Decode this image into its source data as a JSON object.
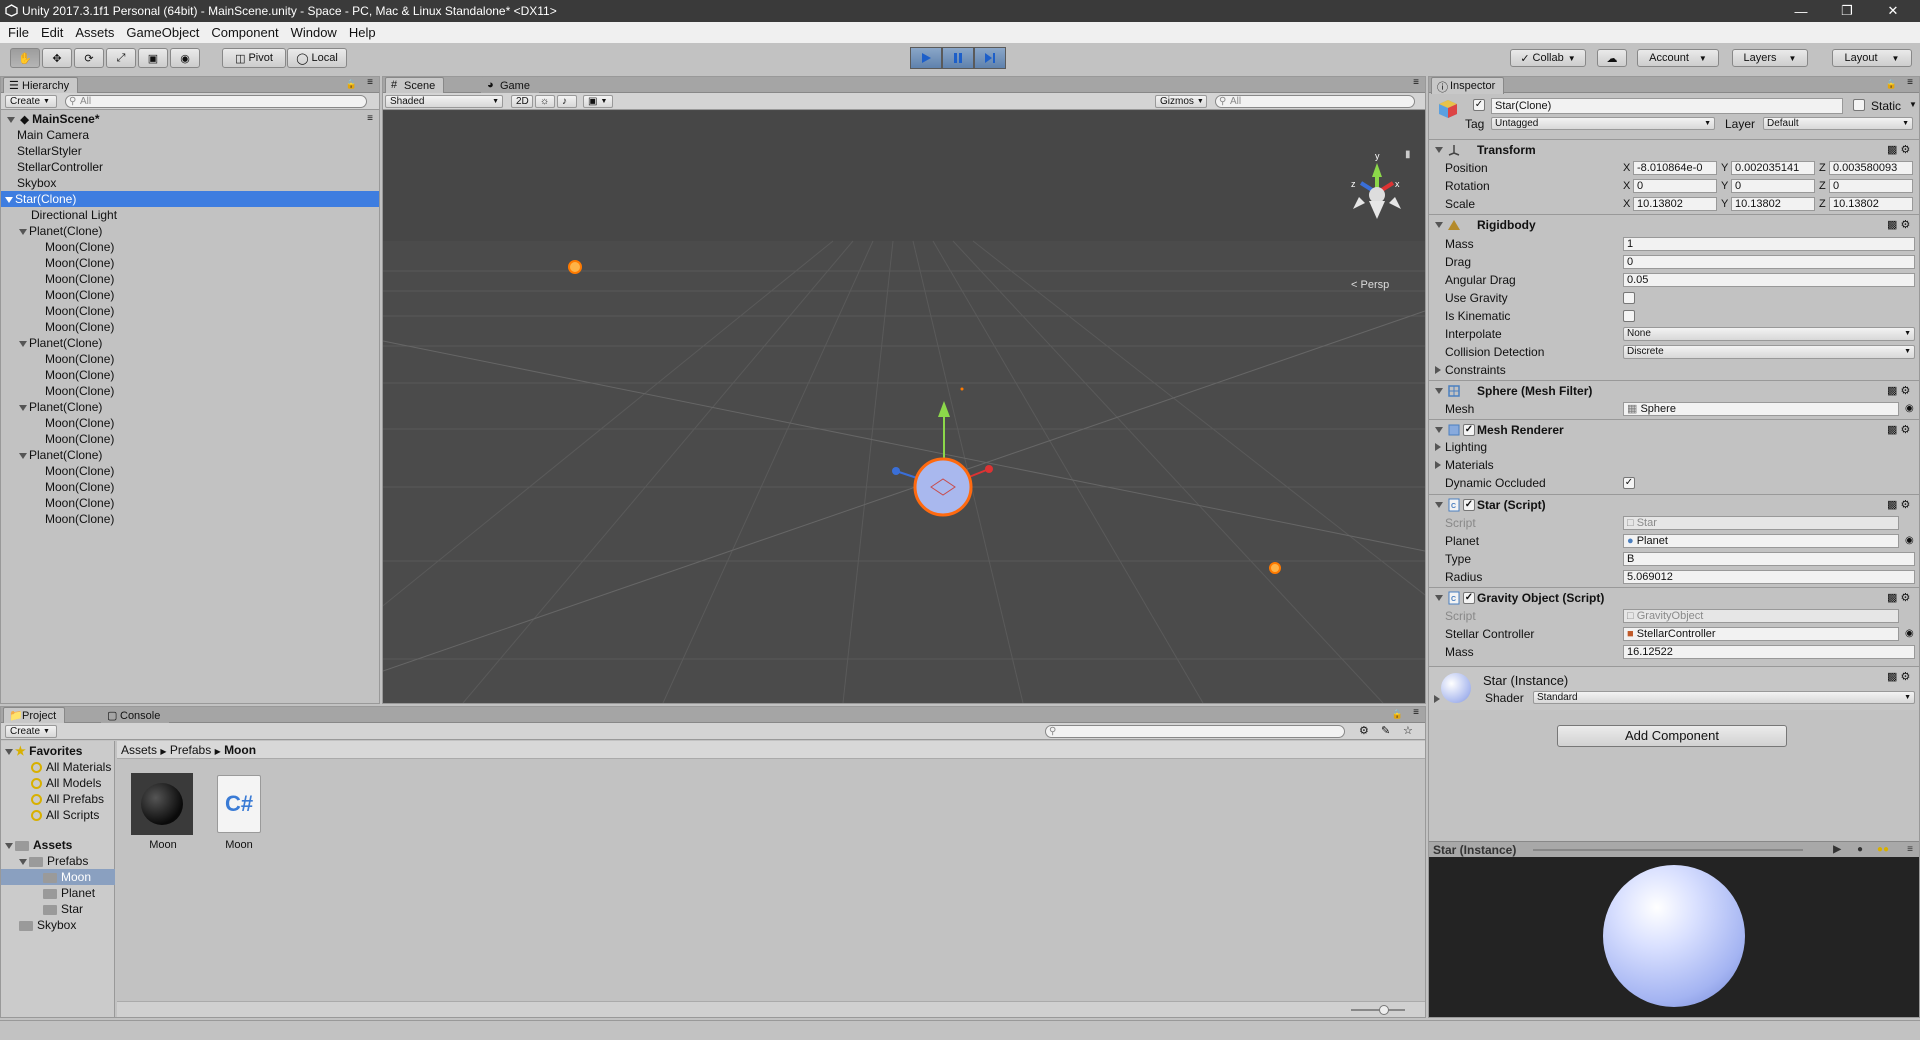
{
  "window": {
    "title": "Unity 2017.3.1f1 Personal (64bit) - MainScene.unity - Space - PC, Mac & Linux Standalone* <DX11>"
  },
  "menu": [
    "File",
    "Edit",
    "Assets",
    "GameObject",
    "Component",
    "Window",
    "Help"
  ],
  "toolbar": {
    "pivot_label": "Pivot",
    "local_label": "Local",
    "collab_label": "Collab",
    "account_label": "Account",
    "layers_label": "Layers",
    "layout_label": "Layout"
  },
  "hierarchy": {
    "tab": "Hierarchy",
    "create_label": "Create",
    "search_placeholder": "All",
    "scene": "MainScene*",
    "items": [
      {
        "label": "Main Camera",
        "depth": 1
      },
      {
        "label": "StellarStyler",
        "depth": 1
      },
      {
        "label": "StellarController",
        "depth": 1
      },
      {
        "label": "Skybox",
        "depth": 1
      },
      {
        "label": "Star(Clone)",
        "depth": 1,
        "selected": true,
        "expand": true
      },
      {
        "label": "Directional Light",
        "depth": 2
      },
      {
        "label": "Planet(Clone)",
        "depth": 2,
        "expand": true
      },
      {
        "label": "Moon(Clone)",
        "depth": 3
      },
      {
        "label": "Moon(Clone)",
        "depth": 3
      },
      {
        "label": "Moon(Clone)",
        "depth": 3
      },
      {
        "label": "Moon(Clone)",
        "depth": 3
      },
      {
        "label": "Moon(Clone)",
        "depth": 3
      },
      {
        "label": "Moon(Clone)",
        "depth": 3
      },
      {
        "label": "Planet(Clone)",
        "depth": 2,
        "expand": true
      },
      {
        "label": "Moon(Clone)",
        "depth": 3
      },
      {
        "label": "Moon(Clone)",
        "depth": 3
      },
      {
        "label": "Moon(Clone)",
        "depth": 3
      },
      {
        "label": "Planet(Clone)",
        "depth": 2,
        "expand": true
      },
      {
        "label": "Moon(Clone)",
        "depth": 3
      },
      {
        "label": "Moon(Clone)",
        "depth": 3
      },
      {
        "label": "Planet(Clone)",
        "depth": 2,
        "expand": true
      },
      {
        "label": "Moon(Clone)",
        "depth": 3
      },
      {
        "label": "Moon(Clone)",
        "depth": 3
      },
      {
        "label": "Moon(Clone)",
        "depth": 3
      },
      {
        "label": "Moon(Clone)",
        "depth": 3
      }
    ]
  },
  "scene": {
    "tab_scene": "Scene",
    "tab_game": "Game",
    "shading": "Shaded",
    "mode_2d": "2D",
    "gizmos": "Gizmos",
    "search_placeholder": "All",
    "persp_label": "Persp"
  },
  "project": {
    "tab_project": "Project",
    "tab_console": "Console",
    "create_label": "Create",
    "favorites_label": "Favorites",
    "favorites": [
      "All Materials",
      "All Models",
      "All Prefabs",
      "All Scripts"
    ],
    "assets_label": "Assets",
    "tree": [
      {
        "label": "Prefabs",
        "depth": 1,
        "expand": true
      },
      {
        "label": "Moon",
        "depth": 2,
        "selected": true
      },
      {
        "label": "Planet",
        "depth": 2
      },
      {
        "label": "Star",
        "depth": 2
      },
      {
        "label": "Skybox",
        "depth": 1
      }
    ],
    "breadcrumb": [
      "Assets",
      "Prefabs",
      "Moon"
    ],
    "items": [
      {
        "label": "Moon",
        "kind": "sphere"
      },
      {
        "label": "Moon",
        "kind": "script"
      }
    ]
  },
  "inspector": {
    "tab": "Inspector",
    "object_name": "Star(Clone)",
    "static_label": "Static",
    "tag_label": "Tag",
    "tag_value": "Untagged",
    "layer_label": "Layer",
    "layer_value": "Default",
    "transform": {
      "title": "Transform",
      "position_label": "Position",
      "rotation_label": "Rotation",
      "scale_label": "Scale",
      "position": [
        "-8.010864e-0",
        "0.002035141",
        "0.003580093"
      ],
      "rotation": [
        "0",
        "0",
        "0"
      ],
      "scale": [
        "10.13802",
        "10.13802",
        "10.13802"
      ]
    },
    "rigidbody": {
      "title": "Rigidbody",
      "mass_label": "Mass",
      "mass": "1",
      "drag_label": "Drag",
      "drag": "0",
      "angular_drag_label": "Angular Drag",
      "angular_drag": "0.05",
      "use_gravity_label": "Use Gravity",
      "is_kinematic_label": "Is Kinematic",
      "interpolate_label": "Interpolate",
      "interpolate": "None",
      "collision_label": "Collision Detection",
      "collision": "Discrete",
      "constraints_label": "Constraints"
    },
    "mesh_filter": {
      "title": "Sphere (Mesh Filter)",
      "mesh_label": "Mesh",
      "mesh": "Sphere"
    },
    "mesh_renderer": {
      "title": "Mesh Renderer",
      "lighting_label": "Lighting",
      "materials_label": "Materials",
      "dynamic_label": "Dynamic Occluded"
    },
    "star_script": {
      "title": "Star (Script)",
      "script_label": "Script",
      "script": "Star",
      "planet_label": "Planet",
      "planet": "Planet",
      "type_label": "Type",
      "type": "B",
      "radius_label": "Radius",
      "radius": "5.069012"
    },
    "gravity_script": {
      "title": "Gravity Object (Script)",
      "script_label": "Script",
      "script": "GravityObject",
      "controller_label": "Stellar Controller",
      "controller": "StellarController",
      "mass_label": "Mass",
      "mass": "16.12522"
    },
    "material": {
      "name": "Star (Instance)",
      "shader_label": "Shader",
      "shader": "Standard"
    },
    "add_component_label": "Add Component",
    "preview_title": "Star (Instance)"
  },
  "colors": {
    "accent": "#3e7de0",
    "scene_bg": "#4a4a4a",
    "star": "#ff8a1e",
    "play": "#5f82ad"
  }
}
